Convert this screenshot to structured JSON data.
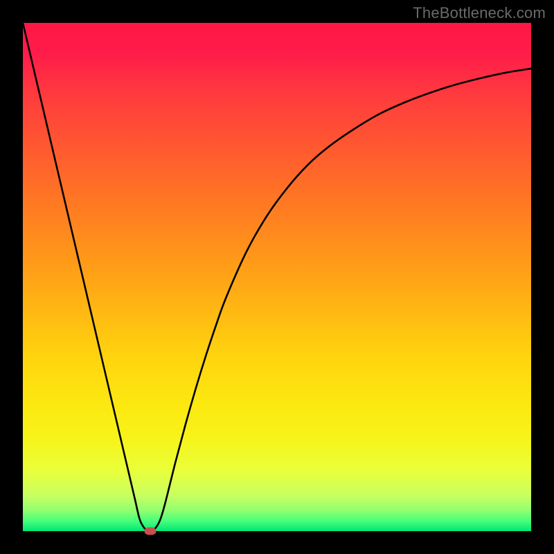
{
  "watermark": {
    "text": "TheBottleneck.com"
  },
  "colors": {
    "curve": "#000000",
    "marker": "#c94f4f",
    "frame": "#000000"
  },
  "chart_data": {
    "type": "line",
    "title": "",
    "xlabel": "",
    "ylabel": "",
    "xlim": [
      0,
      100
    ],
    "ylim": [
      0,
      100
    ],
    "grid": false,
    "legend": false,
    "annotations": [],
    "series": [
      {
        "name": "bottleneck-curve",
        "x": [
          0,
          2,
          4,
          6,
          8,
          10,
          12,
          14,
          16,
          18,
          20,
          22,
          23,
          24,
          25,
          26,
          27,
          28,
          30,
          32,
          34,
          36,
          38,
          40,
          44,
          48,
          52,
          56,
          60,
          65,
          70,
          75,
          80,
          85,
          90,
          95,
          100
        ],
        "y": [
          100,
          91.5,
          83,
          74.5,
          66,
          57.5,
          49,
          40.5,
          32,
          23.5,
          15,
          6.5,
          2.3,
          0.5,
          0,
          0.5,
          2.2,
          5.5,
          13.5,
          21,
          28,
          34.5,
          40.5,
          46,
          55,
          62,
          67.5,
          72,
          75.5,
          79,
          82,
          84.3,
          86.2,
          87.8,
          89.1,
          90.2,
          91
        ]
      }
    ],
    "minimum": {
      "x": 25,
      "y": 0
    }
  }
}
